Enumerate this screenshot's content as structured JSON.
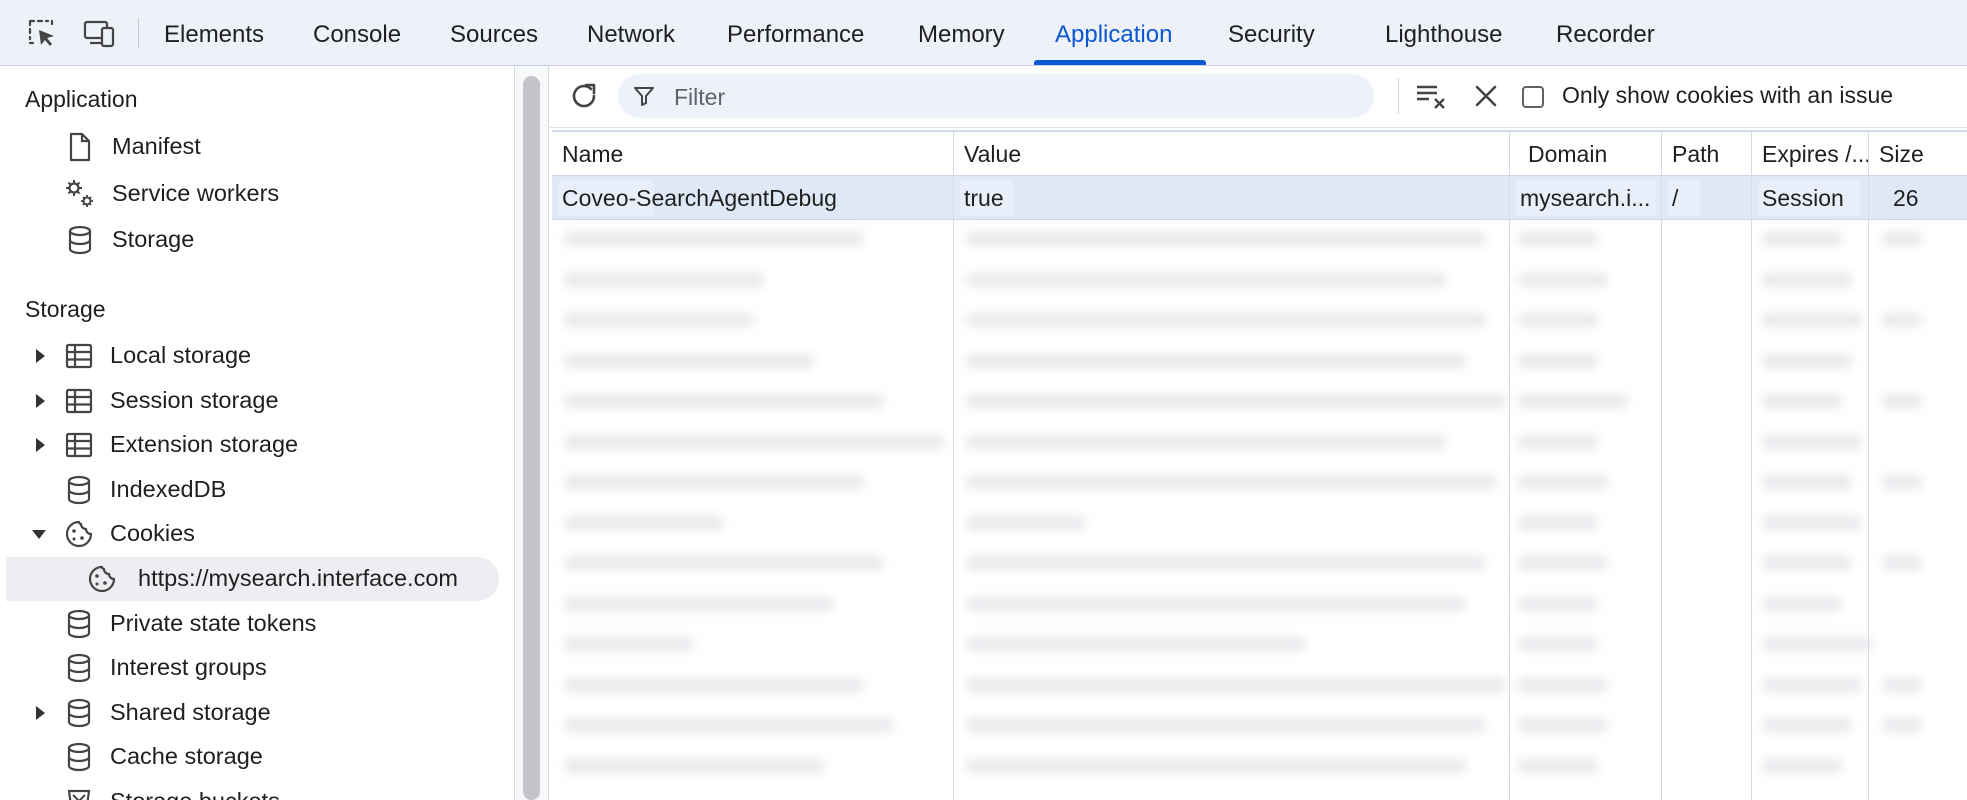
{
  "devtools_tabs": [
    {
      "label": "Elements",
      "active": false
    },
    {
      "label": "Console",
      "active": false
    },
    {
      "label": "Sources",
      "active": false
    },
    {
      "label": "Network",
      "active": false
    },
    {
      "label": "Performance",
      "active": false
    },
    {
      "label": "Memory",
      "active": false
    },
    {
      "label": "Application",
      "active": true
    },
    {
      "label": "Security",
      "active": false
    },
    {
      "label": "Lighthouse",
      "active": false
    },
    {
      "label": "Recorder",
      "active": false
    }
  ],
  "toolbar_icons": [
    "inspect-element-icon",
    "device-toolbar-icon"
  ],
  "sidebar": {
    "application_heading": "Application",
    "application_items": [
      {
        "label": "Manifest",
        "icon": "document-icon"
      },
      {
        "label": "Service workers",
        "icon": "gears-icon"
      },
      {
        "label": "Storage",
        "icon": "database-icon"
      }
    ],
    "storage_heading": "Storage",
    "storage_items": [
      {
        "label": "Local storage",
        "icon": "table-icon",
        "expander": "collapsed"
      },
      {
        "label": "Session storage",
        "icon": "table-icon",
        "expander": "collapsed"
      },
      {
        "label": "Extension storage",
        "icon": "table-icon",
        "expander": "collapsed"
      },
      {
        "label": "IndexedDB",
        "icon": "database-icon",
        "expander": "none"
      },
      {
        "label": "Cookies",
        "icon": "cookie-icon",
        "expander": "expanded"
      },
      {
        "label": "https://mysearch.interface.com",
        "icon": "cookie-icon",
        "expander": "none",
        "selected": true,
        "child": true
      },
      {
        "label": "Private state tokens",
        "icon": "database-icon",
        "expander": "none"
      },
      {
        "label": "Interest groups",
        "icon": "database-icon",
        "expander": "none"
      },
      {
        "label": "Shared storage",
        "icon": "database-icon",
        "expander": "collapsed"
      },
      {
        "label": "Cache storage",
        "icon": "database-icon",
        "expander": "none"
      },
      {
        "label": "Storage buckets",
        "icon": "buckets-icon",
        "expander": "none"
      }
    ]
  },
  "cookies_toolbar": {
    "filter_placeholder": "Filter",
    "only_issue_label": "Only show cookies with an issue",
    "only_issue_checked": false
  },
  "cookies_table": {
    "columns": [
      "Name",
      "Value",
      "Domain",
      "Path",
      "Expires /...",
      "Size"
    ],
    "rows": [
      {
        "name": "Coveo-SearchAgentDebug",
        "value": "true",
        "domain": "mysearch.i...",
        "path": "/",
        "expires": "Session",
        "size": "26"
      }
    ]
  },
  "colors": {
    "accent": "#0b57d0",
    "topbar_bg": "#eef2f8",
    "selected_row": "#dfe8f7"
  }
}
